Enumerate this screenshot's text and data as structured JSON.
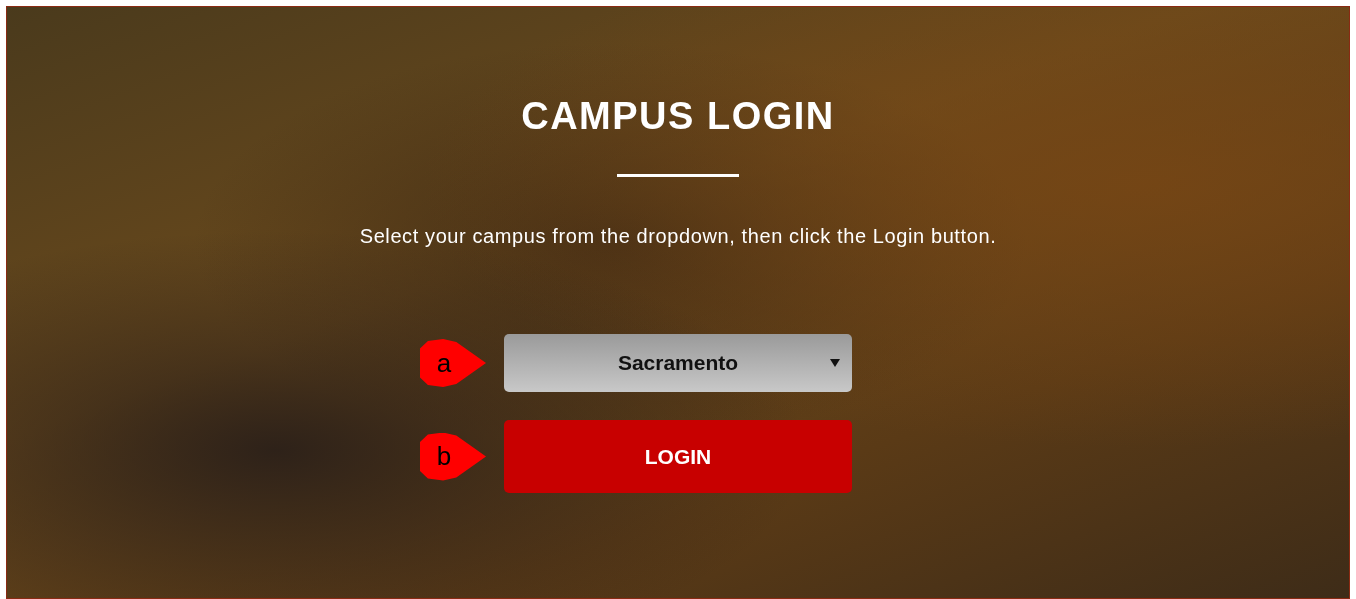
{
  "title": "CAMPUS LOGIN",
  "instruction": "Select your campus from the dropdown, then click the Login button.",
  "campus_select": {
    "value": "Sacramento",
    "callout": "a"
  },
  "login_button": {
    "label": "LOGIN",
    "callout": "b"
  }
}
